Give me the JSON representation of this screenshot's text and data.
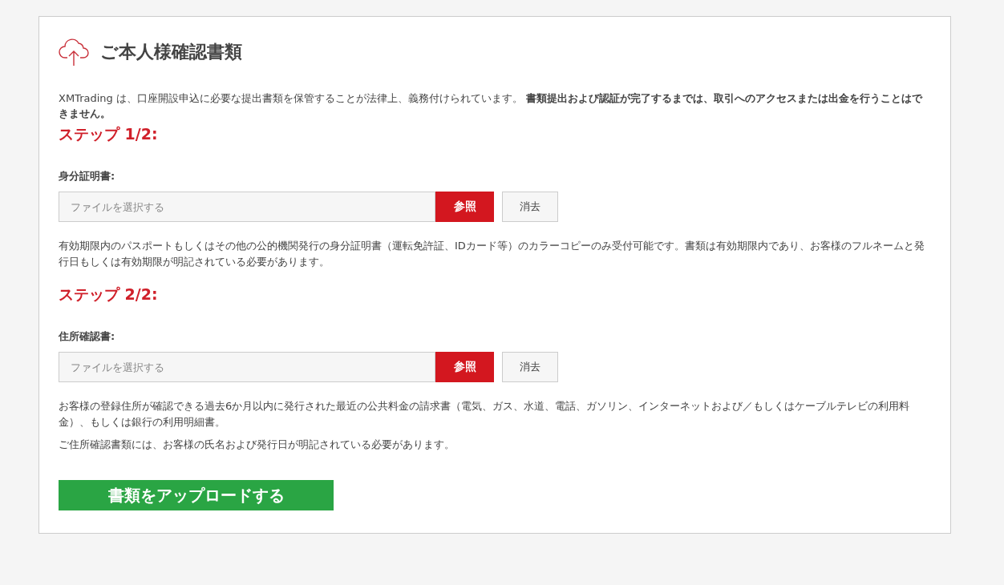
{
  "title": "ご本人様確認書類",
  "intro": "XMTrading は、口座開設申込に必要な提出書類を保管することが法律上、義務付けられています。 **書類提出および認証が完了するまでは、取引へのアクセスまたは出金を行うことはできません。**",
  "steps": [
    {
      "heading": "ステップ 1/2:",
      "label": "身分証明書:",
      "placeholder": "ファイルを選択する",
      "browse": "参照",
      "clear": "消去",
      "notes": [
        "有効期限内のパスポートもしくはその他の公的機関発行の身分証明書（運転免許証、IDカード等）のカラーコピーのみ受付可能です。書類は有効期限内であり、お客様のフルネームと発行日もしくは有効期限が明記されている必要があります。"
      ]
    },
    {
      "heading": "ステップ 2/2:",
      "label": "住所確認書:",
      "placeholder": "ファイルを選択する",
      "browse": "参照",
      "clear": "消去",
      "notes": [
        "お客様の登録住所が確認できる過去6か月以内に発行された最近の公共料金の請求書（電気、ガス、水道、電話、ガソリン、インターネットおよび／もしくはケーブルテレビの利用料金）、もしくは銀行の利用明細書。",
        "ご住所確認書類には、お客様の氏名および発行日が明記されている必要があります。"
      ]
    }
  ],
  "submit": "書類をアップロードする"
}
